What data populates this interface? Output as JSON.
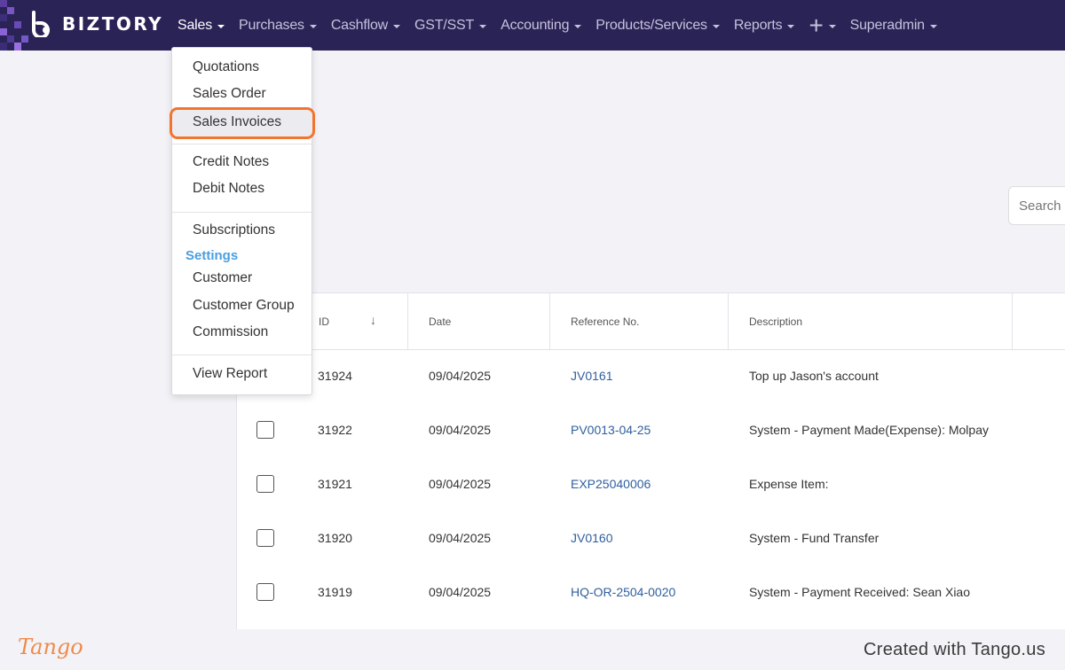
{
  "app": {
    "brand": "BIZTORY"
  },
  "nav": {
    "items": [
      {
        "label": "Sales",
        "active": true
      },
      {
        "label": "Purchases"
      },
      {
        "label": "Cashflow"
      },
      {
        "label": "GST/SST"
      },
      {
        "label": "Accounting"
      },
      {
        "label": "Products/Services"
      },
      {
        "label": "Reports"
      }
    ],
    "user": "Superadmin"
  },
  "dropdown": {
    "items": {
      "quotations": "Quotations",
      "sales_order": "Sales Order",
      "sales_invoices": "Sales Invoices",
      "credit_notes": "Credit Notes",
      "debit_notes": "Debit Notes",
      "subscriptions": "Subscriptions",
      "settings_header": "Settings",
      "customer": "Customer",
      "customer_group": "Customer Group",
      "commission": "Commission",
      "view_report": "View Report"
    },
    "highlighted": "sales_invoices"
  },
  "search": {
    "placeholder": "Search"
  },
  "table": {
    "headers": {
      "id": "ID",
      "date": "Date",
      "reference": "Reference No.",
      "description": "Description"
    },
    "rows": [
      {
        "id": "31924",
        "date": "09/04/2025",
        "ref": "JV0161",
        "desc": "Top up Jason's account"
      },
      {
        "id": "31922",
        "date": "09/04/2025",
        "ref": "PV0013-04-25",
        "desc": "System - Payment Made(Expense): Molpay"
      },
      {
        "id": "31921",
        "date": "09/04/2025",
        "ref": "EXP25040006",
        "desc": "Expense Item:"
      },
      {
        "id": "31920",
        "date": "09/04/2025",
        "ref": "JV0160",
        "desc": "System - Fund Transfer"
      },
      {
        "id": "31919",
        "date": "09/04/2025",
        "ref": "HQ-OR-2504-0020",
        "desc": "System - Payment Received: Sean Xiao"
      }
    ]
  },
  "footer": {
    "tango": "Tango",
    "created": "Created with Tango.us"
  },
  "colors": {
    "navbar": "#2a2356",
    "highlight": "#f2742f",
    "link": "#2f5f9e",
    "settings": "#4a9fe0"
  }
}
